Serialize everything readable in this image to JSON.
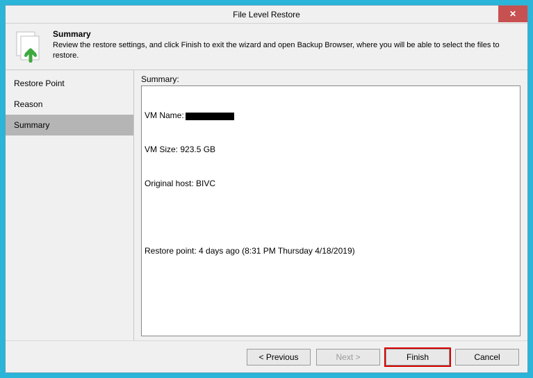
{
  "window": {
    "title": "File Level Restore",
    "close_glyph": "✕"
  },
  "header": {
    "title": "Summary",
    "description": "Review the restore settings, and click Finish to exit the wizard and open Backup Browser, where you will be able to select the files to restore."
  },
  "sidebar": {
    "items": [
      {
        "label": "Restore Point",
        "active": false
      },
      {
        "label": "Reason",
        "active": false
      },
      {
        "label": "Summary",
        "active": true
      }
    ]
  },
  "main": {
    "summary_label": "Summary:",
    "vm_name_label": "VM Name:",
    "vm_size_line": "VM Size: 923.5 GB",
    "original_host_line": "Original host: BIVC",
    "restore_point_line": "Restore point: 4 days ago (8:31 PM Thursday 4/18/2019)"
  },
  "footer": {
    "previous": "< Previous",
    "next": "Next >",
    "finish": "Finish",
    "cancel": "Cancel"
  }
}
